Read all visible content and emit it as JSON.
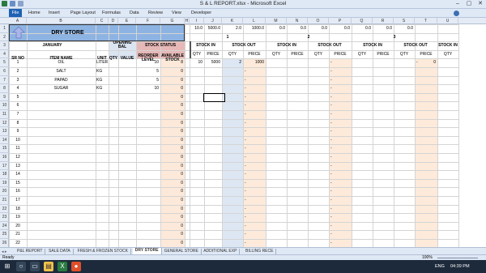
{
  "window": {
    "title": "S & L REPORT.xlsx - Microsoft Excel"
  },
  "ribbon": {
    "file": "File",
    "tabs": [
      "Home",
      "Insert",
      "Page Layout",
      "Formulas",
      "Data",
      "Review",
      "View",
      "Developer"
    ]
  },
  "columns": [
    "A",
    "B",
    "C",
    "D",
    "E",
    "F",
    "G",
    "H",
    "I",
    "J",
    "K",
    "L",
    "M",
    "N",
    "O",
    "P",
    "Q",
    "R",
    "S",
    "T",
    "U"
  ],
  "row1": [
    "10.0",
    "5000.0",
    "2.0",
    "1000.0",
    "0.0",
    "0.0",
    "0.0",
    "0.0",
    "0.0",
    "0.0",
    "0.0"
  ],
  "dry_store": "DRY STORE",
  "period": "JANUARY",
  "headers": {
    "sr_no": "SR NO",
    "item_name": "ITEM NAME",
    "unit": "UNIT",
    "opening_bal": "OPENING BAL",
    "qty": "QTY",
    "value": "VALUE",
    "stock_status": "STOCK STATUS",
    "reorder_level": "REORDER LEVEL",
    "available_stock": "AVAILABLE STOCK",
    "stock_in": "STOCK IN",
    "stock_out": "STOCK OUT",
    "price": "PRICE"
  },
  "days": [
    "1",
    "2",
    "3"
  ],
  "rows": [
    {
      "sr": "1",
      "item": "OIL",
      "unit": "LITER",
      "reorder": "10",
      "avail": "8",
      "in_qty": "10",
      "in_price": "5000",
      "out_qty": "2",
      "out_price": "1000"
    },
    {
      "sr": "2",
      "item": "SALT",
      "unit": "KG",
      "reorder": "5",
      "avail": "0"
    },
    {
      "sr": "3",
      "item": "PAPAD",
      "unit": "KG",
      "reorder": "5",
      "avail": "0"
    },
    {
      "sr": "4",
      "item": "SUGAR",
      "unit": "KG",
      "reorder": "10",
      "avail": "0"
    }
  ],
  "row_numbers": [
    "1",
    "2",
    "3",
    "4",
    "5",
    "6",
    "7",
    "8",
    "9",
    "10",
    "11",
    "12",
    "13",
    "14",
    "15",
    "16",
    "17",
    "18",
    "19",
    "20",
    "21",
    "22",
    "23",
    "24",
    "25",
    "26"
  ],
  "extra_sr": [
    "5",
    "6",
    "7",
    "8",
    "9",
    "10",
    "11",
    "12",
    "13",
    "14",
    "15",
    "16",
    "17",
    "18",
    "19",
    "20",
    "21",
    "22",
    "23",
    "24",
    "25",
    "26"
  ],
  "zero": "0",
  "dash": "-",
  "sheet_tabs": [
    "P&L REPORT",
    "SALE DATA",
    "FRESH & FROZEN STOCK",
    "DRY STORE",
    "GENERAL STORE",
    "ADDITIONAL EXP",
    "BILLING RECE"
  ],
  "active_tab": "DRY STORE",
  "status": {
    "ready": "Ready",
    "zoom": "100%"
  },
  "taskbar": {
    "lang": "ENG",
    "time": "04:39 PM"
  },
  "colors": {
    "title_fill": "#8db3e2",
    "stock_fill": "#e6b8b7",
    "reorder_fill": "#e6b8b7",
    "day_fill": "#b4f0b4",
    "stockin_fill": "#ffff66",
    "stockout_fill": "#ffff66",
    "avail_col": "#fde9d9",
    "out_col": "#dde7f3",
    "price_col": "#fdeada"
  }
}
